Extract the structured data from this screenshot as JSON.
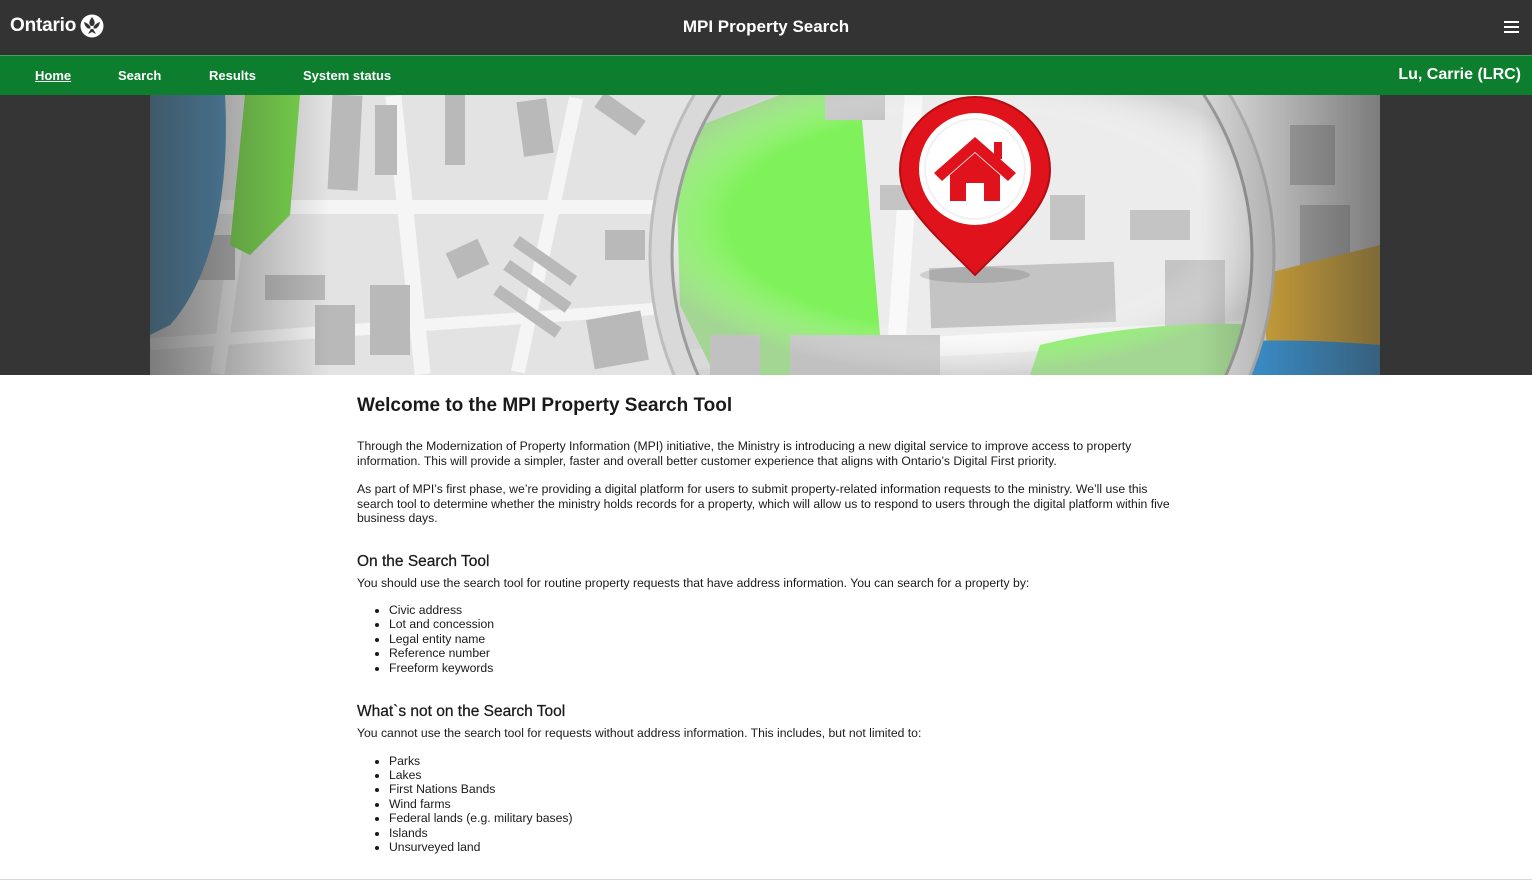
{
  "header": {
    "logo_text": "Ontario",
    "title": "MPI Property Search",
    "menu_icon": "hamburger-icon"
  },
  "nav": {
    "items": [
      {
        "label": "Home",
        "active": true
      },
      {
        "label": "Search",
        "active": false
      },
      {
        "label": "Results",
        "active": false
      },
      {
        "label": "System status",
        "active": false
      }
    ],
    "user": "Lu, Carrie (LRC)"
  },
  "colors": {
    "topbar": "#333333",
    "navbar": "#0d7e2d",
    "pin": "#e0121b"
  },
  "hero": {
    "image": "map-magnifier-house-pin"
  },
  "main": {
    "heading": "Welcome to the MPI Property Search Tool",
    "intro1": "Through the Modernization of Property Information (MPI) initiative, the Ministry is introducing a new digital service to improve access to property information. This will provide a simpler, faster and overall better customer experience that aligns with Ontario’s Digital First priority.",
    "intro2": "As part of MPI’s first phase, we’re providing a digital platform for users to submit property-related information requests to the ministry. We’ll use this search tool to determine whether the ministry holds records for a property, which will allow us to respond to users through the digital platform within five business days.",
    "section1": {
      "heading": "On the Search Tool",
      "text": "You should use the search tool for routine property requests that have address information. You can search for a property by:",
      "items": [
        "Civic address",
        "Lot and concession",
        "Legal entity name",
        "Reference number",
        "Freeform keywords"
      ]
    },
    "section2": {
      "heading": "What`s not on the Search Tool",
      "text": "You cannot use the search tool for requests without address information. This includes, but not limited to:",
      "items": [
        "Parks",
        "Lakes",
        "First Nations Bands",
        "Wind farms",
        "Federal lands (e.g. military bases)",
        "Islands",
        "Unsurveyed land"
      ]
    }
  }
}
